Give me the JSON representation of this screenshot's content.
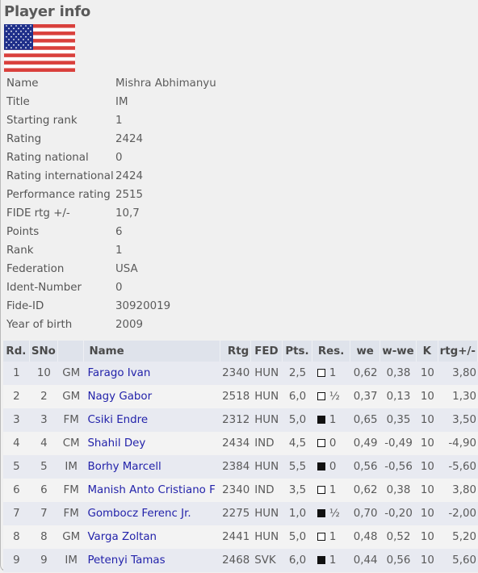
{
  "header": {
    "title": "Player info",
    "flag_icon": "usa-flag-icon"
  },
  "player": [
    {
      "label": "Name",
      "value": "Mishra Abhimanyu"
    },
    {
      "label": "Title",
      "value": "IM"
    },
    {
      "label": "Starting rank",
      "value": "1"
    },
    {
      "label": "Rating",
      "value": "2424"
    },
    {
      "label": "Rating national",
      "value": "0"
    },
    {
      "label": "Rating international",
      "value": "2424"
    },
    {
      "label": "Performance rating",
      "value": "2515"
    },
    {
      "label": "FIDE rtg +/-",
      "value": "10,7"
    },
    {
      "label": "Points",
      "value": "6"
    },
    {
      "label": "Rank",
      "value": "1"
    },
    {
      "label": "Federation",
      "value": "USA"
    },
    {
      "label": "Ident-Number",
      "value": "0"
    },
    {
      "label": "Fide-ID",
      "value": "30920019"
    },
    {
      "label": "Year of birth",
      "value": "2009"
    }
  ],
  "games": {
    "columns": [
      "Rd.",
      "SNo",
      "",
      "Name",
      "Rtg",
      "FED",
      "Pts.",
      "Res.",
      "we",
      "w-we",
      "K",
      "rtg+/-"
    ],
    "rows": [
      {
        "rd": "1",
        "sno": "10",
        "title": "GM",
        "name": "Farago Ivan",
        "rtg": "2340",
        "fed": "HUN",
        "pts": "2,5",
        "color": "white",
        "res": "1",
        "we": "0,62",
        "wwe": "0,38",
        "k": "10",
        "rtgd": "3,80"
      },
      {
        "rd": "2",
        "sno": "2",
        "title": "GM",
        "name": "Nagy Gabor",
        "rtg": "2518",
        "fed": "HUN",
        "pts": "6,0",
        "color": "white",
        "res": "½",
        "we": "0,37",
        "wwe": "0,13",
        "k": "10",
        "rtgd": "1,30"
      },
      {
        "rd": "3",
        "sno": "3",
        "title": "FM",
        "name": "Csiki Endre",
        "rtg": "2312",
        "fed": "HUN",
        "pts": "5,0",
        "color": "black",
        "res": "1",
        "we": "0,65",
        "wwe": "0,35",
        "k": "10",
        "rtgd": "3,50"
      },
      {
        "rd": "4",
        "sno": "4",
        "title": "CM",
        "name": "Shahil Dey",
        "rtg": "2434",
        "fed": "IND",
        "pts": "4,5",
        "color": "white",
        "res": "0",
        "we": "0,49",
        "wwe": "-0,49",
        "k": "10",
        "rtgd": "-4,90"
      },
      {
        "rd": "5",
        "sno": "5",
        "title": "IM",
        "name": "Borhy Marcell",
        "rtg": "2384",
        "fed": "HUN",
        "pts": "5,5",
        "color": "black",
        "res": "0",
        "we": "0,56",
        "wwe": "-0,56",
        "k": "10",
        "rtgd": "-5,60"
      },
      {
        "rd": "6",
        "sno": "6",
        "title": "FM",
        "name": "Manish Anto Cristiano F",
        "rtg": "2340",
        "fed": "IND",
        "pts": "3,5",
        "color": "white",
        "res": "1",
        "we": "0,62",
        "wwe": "0,38",
        "k": "10",
        "rtgd": "3,80"
      },
      {
        "rd": "7",
        "sno": "7",
        "title": "FM",
        "name": "Gombocz Ferenc Jr.",
        "rtg": "2275",
        "fed": "HUN",
        "pts": "1,0",
        "color": "black",
        "res": "½",
        "we": "0,70",
        "wwe": "-0,20",
        "k": "10",
        "rtgd": "-2,00"
      },
      {
        "rd": "8",
        "sno": "8",
        "title": "GM",
        "name": "Varga Zoltan",
        "rtg": "2441",
        "fed": "HUN",
        "pts": "5,0",
        "color": "white",
        "res": "1",
        "we": "0,48",
        "wwe": "0,52",
        "k": "10",
        "rtgd": "5,20"
      },
      {
        "rd": "9",
        "sno": "9",
        "title": "IM",
        "name": "Petenyi Tamas",
        "rtg": "2468",
        "fed": "SVK",
        "pts": "6,0",
        "color": "black",
        "res": "1",
        "we": "0,44",
        "wwe": "0,56",
        "k": "10",
        "rtgd": "5,60"
      }
    ]
  },
  "colors": {
    "link": "#2222aa",
    "header_bg": "#dfe3eb",
    "row_odd": "#e8eaf1",
    "row_even": "#f3f3f3",
    "page_bg": "#f0f0f0"
  }
}
